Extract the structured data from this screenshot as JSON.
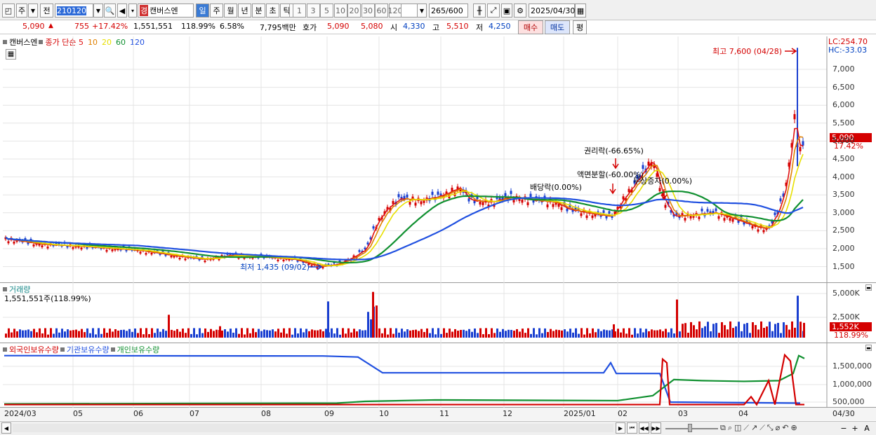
{
  "toolbar": {
    "period_toggle": "주",
    "prev_label": "전",
    "code": "210120",
    "company_badge": "경",
    "company": "캔버스엔",
    "periods": [
      "일",
      "주",
      "월",
      "년",
      "분",
      "초",
      "틱"
    ],
    "nums": [
      "1",
      "3",
      "5",
      "10",
      "20",
      "30",
      "60",
      "120"
    ],
    "count": "265",
    "count_total": "/600",
    "date": "2025/04/30"
  },
  "quote": {
    "price": "5,090",
    "change": "755",
    "change_pct": "+17.42%",
    "volume": "1,551,551",
    "vol_ratio": "118.99%",
    "turnover": "6.58%",
    "amount": "7,795백만",
    "hoga_label": "호가",
    "hoga1": "5,090",
    "hoga2": "5,080",
    "open_label": "시",
    "open": "4,330",
    "high_label": "고",
    "high": "5,510",
    "low_label": "저",
    "low": "4,250",
    "buy": "매수",
    "sell": "매도",
    "avg": "평"
  },
  "price_panel": {
    "name": "캔버스엔",
    "ma_title": "종가 단순",
    "ma": [
      {
        "label": "5",
        "color": "#e01010"
      },
      {
        "label": "10",
        "color": "#e08000"
      },
      {
        "label": "20",
        "color": "#e8e000"
      },
      {
        "label": "60",
        "color": "#109030"
      },
      {
        "label": "120",
        "color": "#2050e0"
      }
    ],
    "lc": "LC:254.70",
    "hc": "HC:-33.03",
    "price_tag": "5,090",
    "pct_tag": "17.42%",
    "yticks": [
      "7,000",
      "6,500",
      "6,000",
      "5,500",
      "5,000",
      "4,500",
      "4,000",
      "3,500",
      "3,000",
      "2,500",
      "2,000",
      "1,500"
    ],
    "high_note": "최고 7,600 (04/28)",
    "low_note": "최저 1,435 (09/02)",
    "ann_rights": "권리락(-66.65%)",
    "ann_split": "액면분할(-60.00%)",
    "ann_div": "배당락(0.00%)",
    "ann_cap": "무상증자(0.00%)"
  },
  "vol_panel": {
    "title": "거래량",
    "value": "1,551,551주(118.99%)",
    "yticks": [
      "5,000K",
      "2,500K"
    ],
    "tag": "1,552K",
    "tag2": "118.99%"
  },
  "hold_panel": {
    "s1": "외국인보유수량",
    "s2": "기관보유수량",
    "s3": "개인보유수량",
    "yticks": [
      "1,500,000",
      "1,000,000",
      "500,000"
    ]
  },
  "xaxis": [
    "2024/03",
    "05",
    "06",
    "07",
    "08",
    "09",
    "10",
    "11",
    "12",
    "2025/01",
    "02",
    "03",
    "04",
    "04/30"
  ],
  "colors": {
    "up": "#d40000",
    "down": "#1a3fd0"
  }
}
